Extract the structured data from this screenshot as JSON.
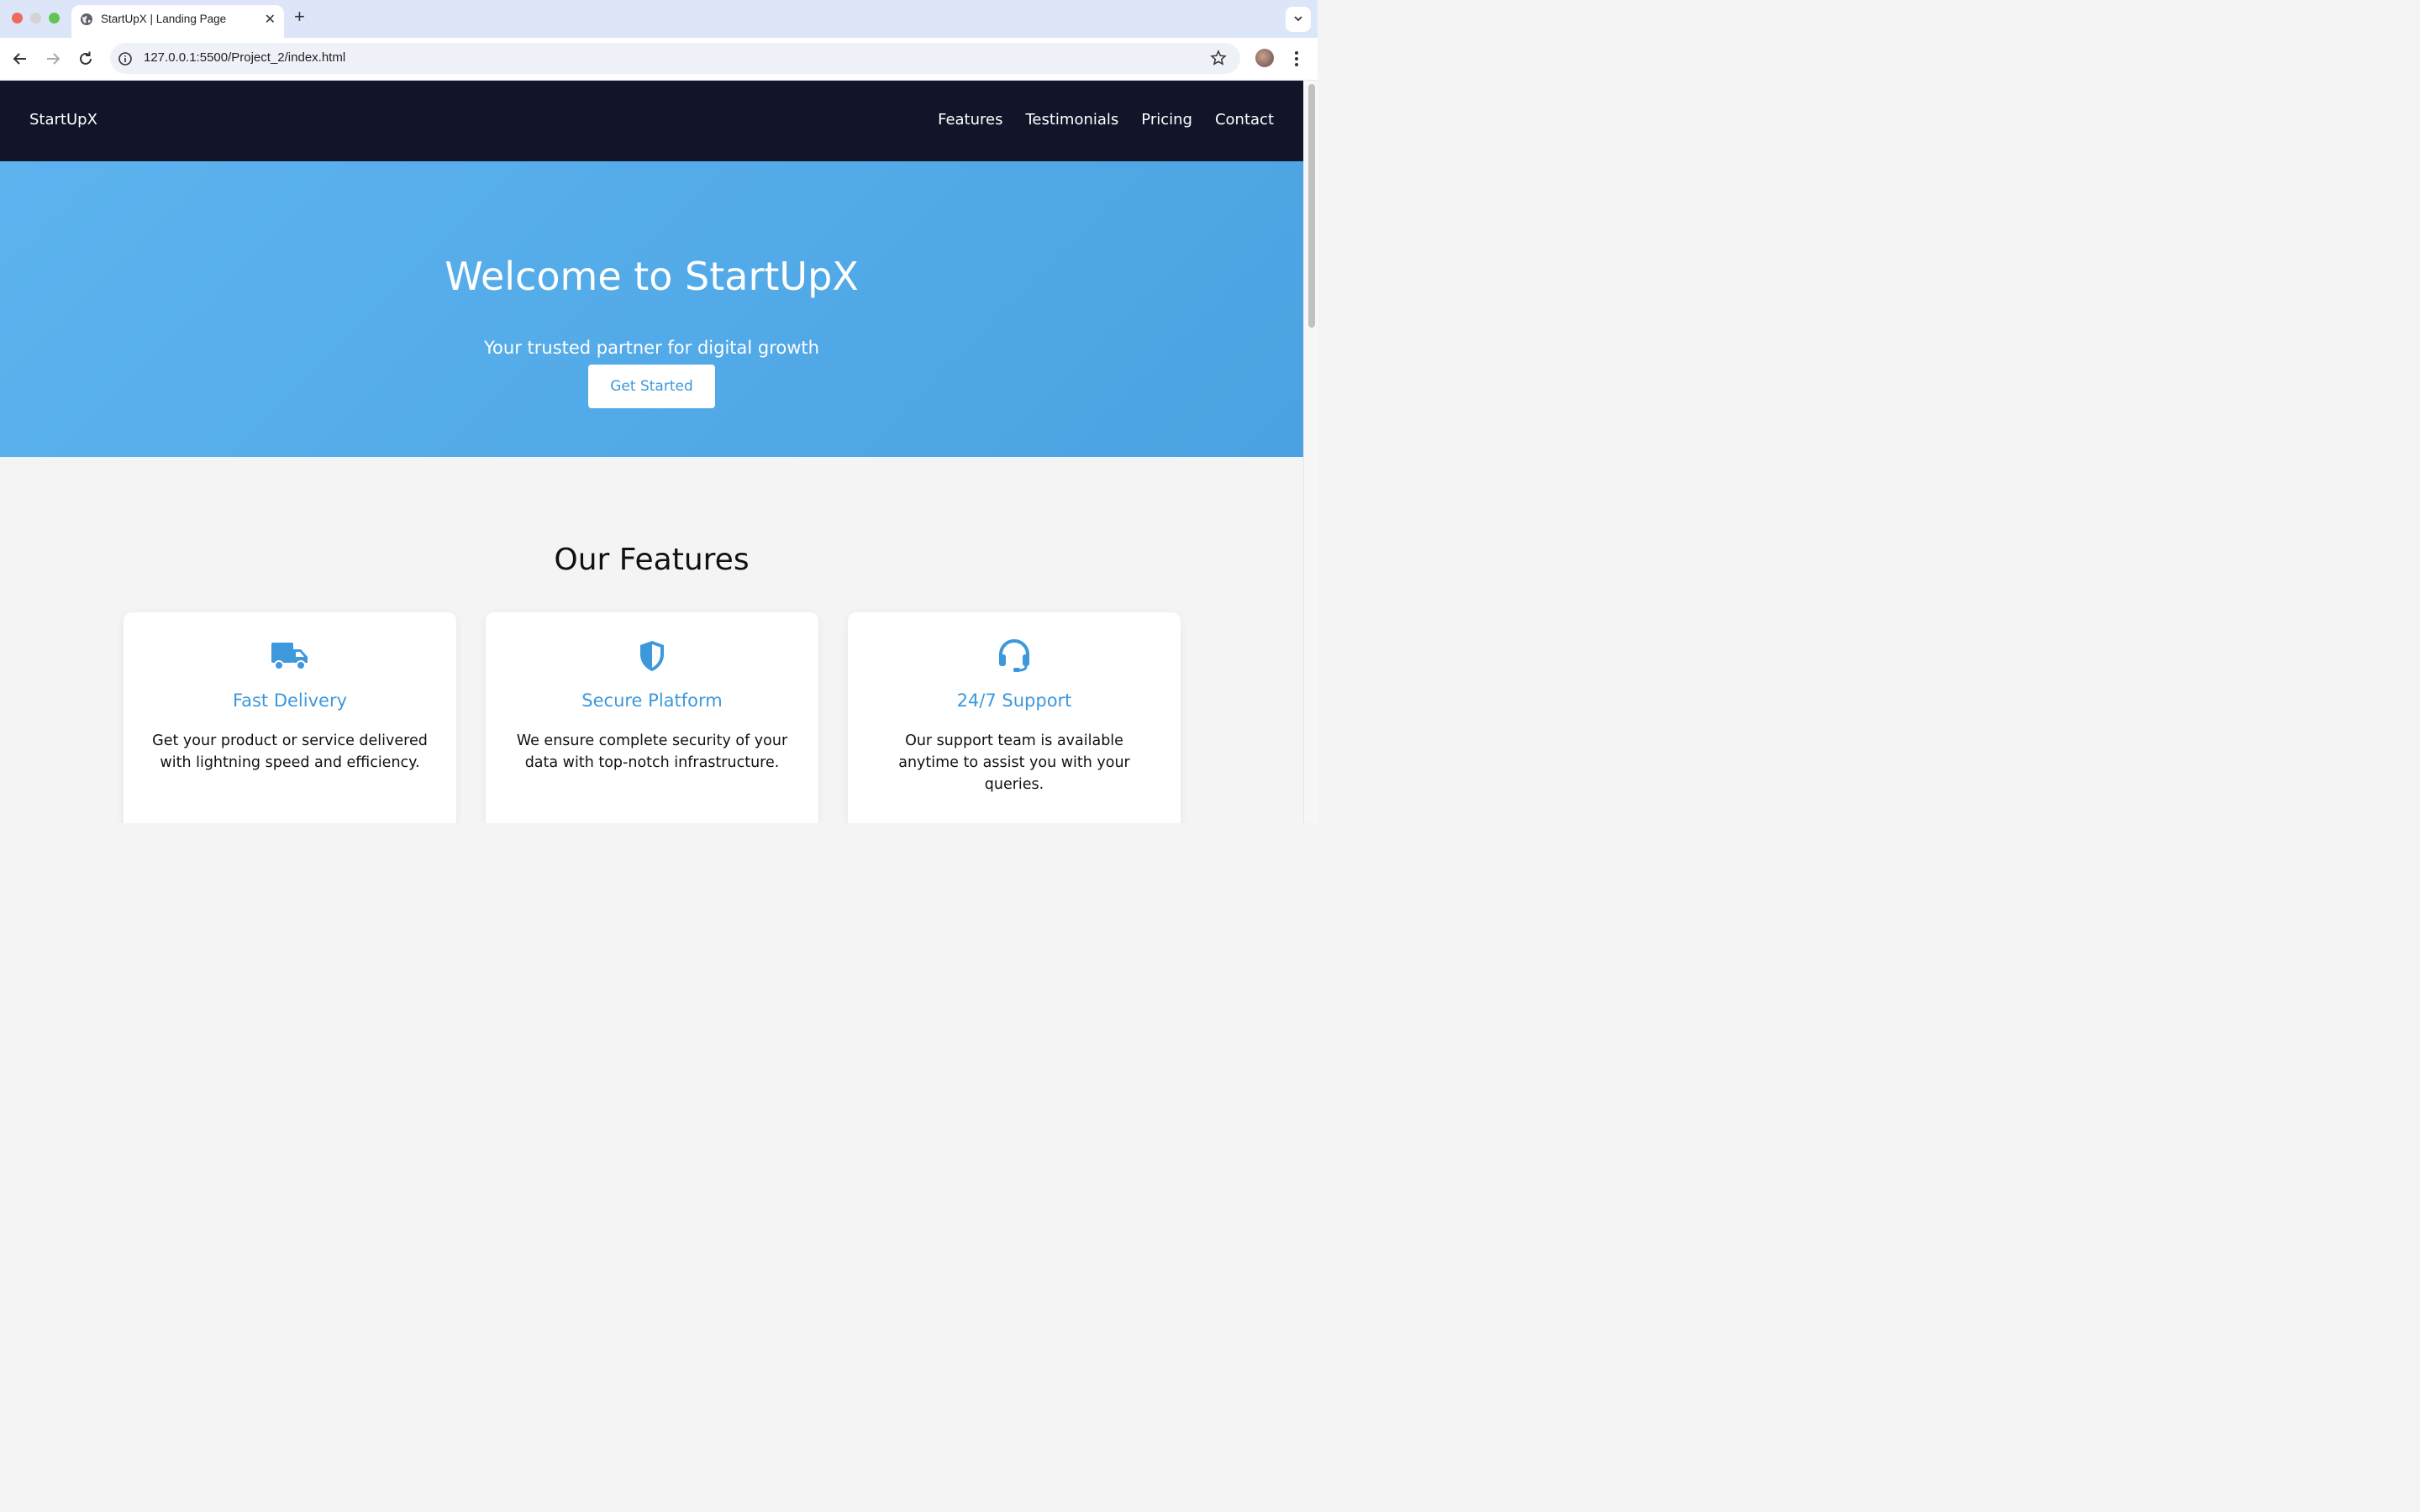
{
  "browser": {
    "tab_title": "StartUpX | Landing Page",
    "url": "127.0.0.1:5500/Project_2/index.html"
  },
  "site": {
    "logo": "StartUpX",
    "nav": [
      "Features",
      "Testimonials",
      "Pricing",
      "Contact"
    ]
  },
  "hero": {
    "title": "Welcome to StartUpX",
    "subtitle": "Your trusted partner for digital growth",
    "cta_label": "Get Started"
  },
  "features": {
    "heading": "Our Features",
    "items": [
      {
        "icon": "truck-icon",
        "title": "Fast Delivery",
        "text": "Get your product or service delivered with lightning speed and efficiency."
      },
      {
        "icon": "shield-icon",
        "title": "Secure Platform",
        "text": "We ensure complete security of your data with top-notch infrastructure."
      },
      {
        "icon": "headset-icon",
        "title": "24/7 Support",
        "text": "Our support team is available anytime to assist you with your queries."
      }
    ]
  },
  "colors": {
    "header_bg": "#12152a",
    "hero_bg": "#52abe9",
    "accent": "#3d98dc"
  }
}
